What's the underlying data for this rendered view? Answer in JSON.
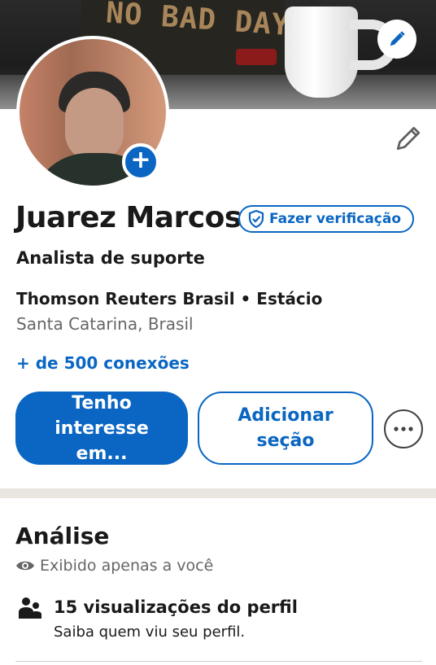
{
  "cover": {
    "board_text": "NO BAD DAYS"
  },
  "profile": {
    "name": "Juarez Marcos",
    "verify_label": "Fazer verificação",
    "headline": "Analista de suporte",
    "company_line": "Thomson Reuters Brasil • Estácio",
    "location": "Santa Catarina, Brasil",
    "connections": "+ de 500 conexões"
  },
  "actions": {
    "primary_label": "Tenho interesse em...",
    "secondary_label": "Adicionar seção"
  },
  "analytics": {
    "title": "Análise",
    "visibility": "Exibido apenas a você",
    "views_title": "15 visualizações do perfil",
    "views_subtitle": "Saiba quem viu seu perfil."
  },
  "colors": {
    "accent": "#0a66c2",
    "text_primary": "#191919",
    "text_secondary": "#666666",
    "divider": "#e9e5df"
  },
  "icons": [
    "pencil-icon",
    "plus-icon",
    "shield-check-icon",
    "more-icon",
    "eye-icon",
    "people-icon"
  ]
}
